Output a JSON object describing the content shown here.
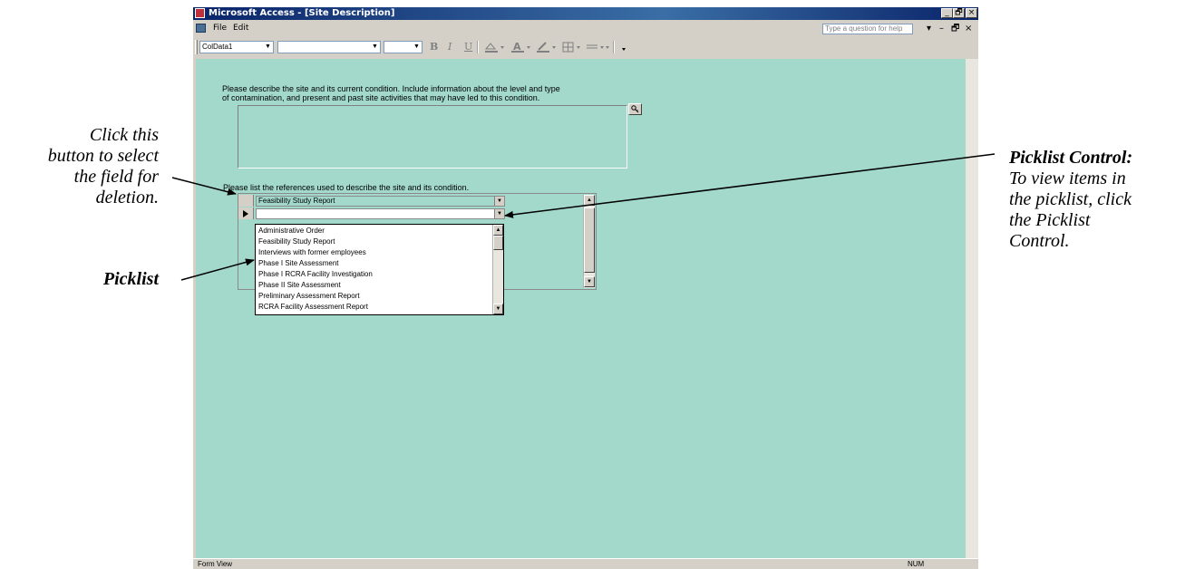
{
  "window": {
    "title": "Microsoft Access - [Site Description]",
    "caption_buttons": [
      "_",
      "🗗",
      "×"
    ]
  },
  "menubar": {
    "items": [
      "File",
      "Edit"
    ],
    "help_placeholder": "Type a question for help",
    "mdi_buttons": [
      "▾",
      "–",
      "🗗",
      "×"
    ]
  },
  "toolbar": {
    "object_combo": "ColData1",
    "font_combo": "",
    "size_combo": "",
    "bold": "B",
    "italic": "I",
    "underline": "U"
  },
  "form": {
    "description_prompt_line1": "Please describe the site and its current condition. Include information about the level and type",
    "description_prompt_line2": "of contamination, and present and past site activities that may have led to this condition.",
    "references_prompt": "Please list the references used to describe the site and its condition.",
    "reference_rows": [
      {
        "value": "Feasibility Study Report"
      },
      {
        "value": ""
      }
    ],
    "picklist_items": [
      "Administrative Order",
      "Feasibility Study Report",
      "Interviews with former employees",
      "Phase I Site Assessment",
      "Phase I RCRA Facility Investigation",
      "Phase II Site Assessment",
      "Preliminary Assessment Report",
      "RCRA Facility Assessment Report"
    ]
  },
  "statusbar": {
    "left": "Form View",
    "right": "NUM"
  },
  "annotations": {
    "select_field": [
      "Click this",
      "button to select",
      "the field for",
      "deletion."
    ],
    "picklist": "Picklist",
    "picklist_control_title": "Picklist Control:",
    "picklist_control_body": [
      "To view items in",
      "the picklist, click",
      "the Picklist",
      "Control."
    ]
  }
}
